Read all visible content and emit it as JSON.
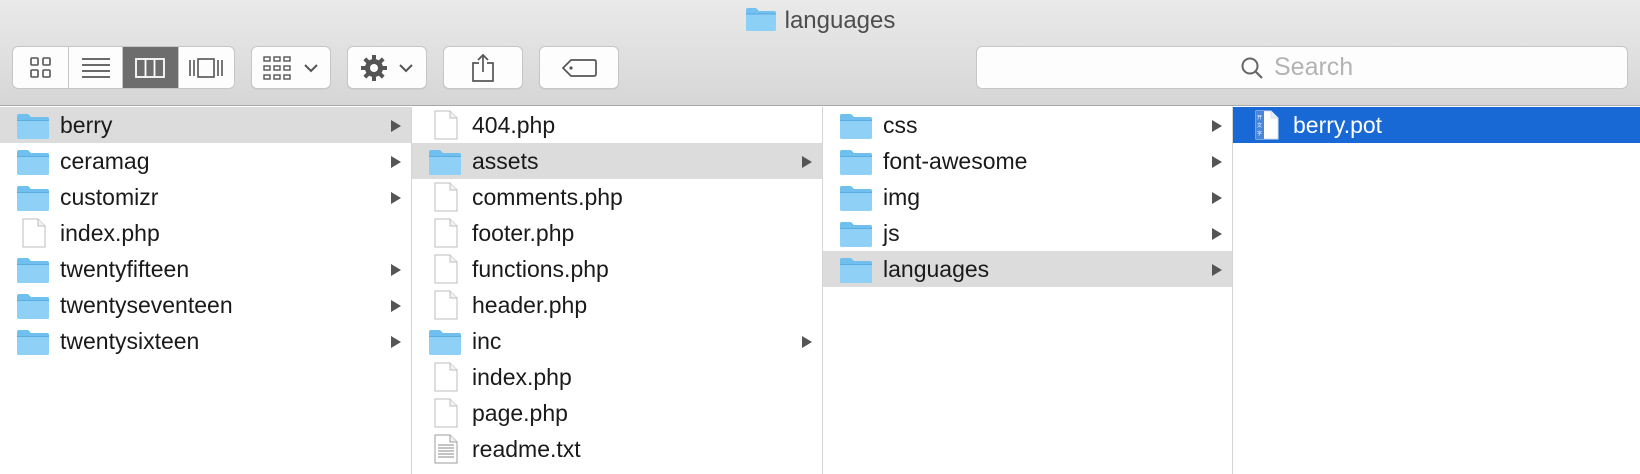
{
  "window": {
    "title": "languages"
  },
  "toolbar": {
    "views": [
      {
        "name": "icon-view",
        "active": false
      },
      {
        "name": "list-view",
        "active": false
      },
      {
        "name": "column-view",
        "active": true
      },
      {
        "name": "cover-flow-view",
        "active": false
      }
    ]
  },
  "search": {
    "placeholder": "Search"
  },
  "columns": [
    {
      "items": [
        {
          "name": "berry",
          "type": "folder",
          "has_children": true,
          "selected": "gray"
        },
        {
          "name": "ceramag",
          "type": "folder",
          "has_children": true
        },
        {
          "name": "customizr",
          "type": "folder",
          "has_children": true
        },
        {
          "name": "index.php",
          "type": "file"
        },
        {
          "name": "twentyfifteen",
          "type": "folder",
          "has_children": true
        },
        {
          "name": "twentyseventeen",
          "type": "folder",
          "has_children": true
        },
        {
          "name": "twentysixteen",
          "type": "folder",
          "has_children": true
        }
      ]
    },
    {
      "items": [
        {
          "name": "404.php",
          "type": "file"
        },
        {
          "name": "assets",
          "type": "folder",
          "has_children": true,
          "selected": "gray"
        },
        {
          "name": "comments.php",
          "type": "file"
        },
        {
          "name": "footer.php",
          "type": "file"
        },
        {
          "name": "functions.php",
          "type": "file"
        },
        {
          "name": "header.php",
          "type": "file"
        },
        {
          "name": "inc",
          "type": "folder",
          "has_children": true
        },
        {
          "name": "index.php",
          "type": "file"
        },
        {
          "name": "page.php",
          "type": "file"
        },
        {
          "name": "readme.txt",
          "type": "text"
        }
      ]
    },
    {
      "items": [
        {
          "name": "css",
          "type": "folder",
          "has_children": true
        },
        {
          "name": "font-awesome",
          "type": "folder",
          "has_children": true
        },
        {
          "name": "img",
          "type": "folder",
          "has_children": true
        },
        {
          "name": "js",
          "type": "folder",
          "has_children": true
        },
        {
          "name": "languages",
          "type": "folder",
          "has_children": true,
          "selected": "gray"
        }
      ]
    },
    {
      "items": [
        {
          "name": "berry.pot",
          "type": "pot",
          "selected": "blue"
        }
      ]
    }
  ],
  "colors": {
    "selection_blue": "#1869d6",
    "selection_gray": "#dcdcdc",
    "folder_blue": "#5fb6ea"
  }
}
